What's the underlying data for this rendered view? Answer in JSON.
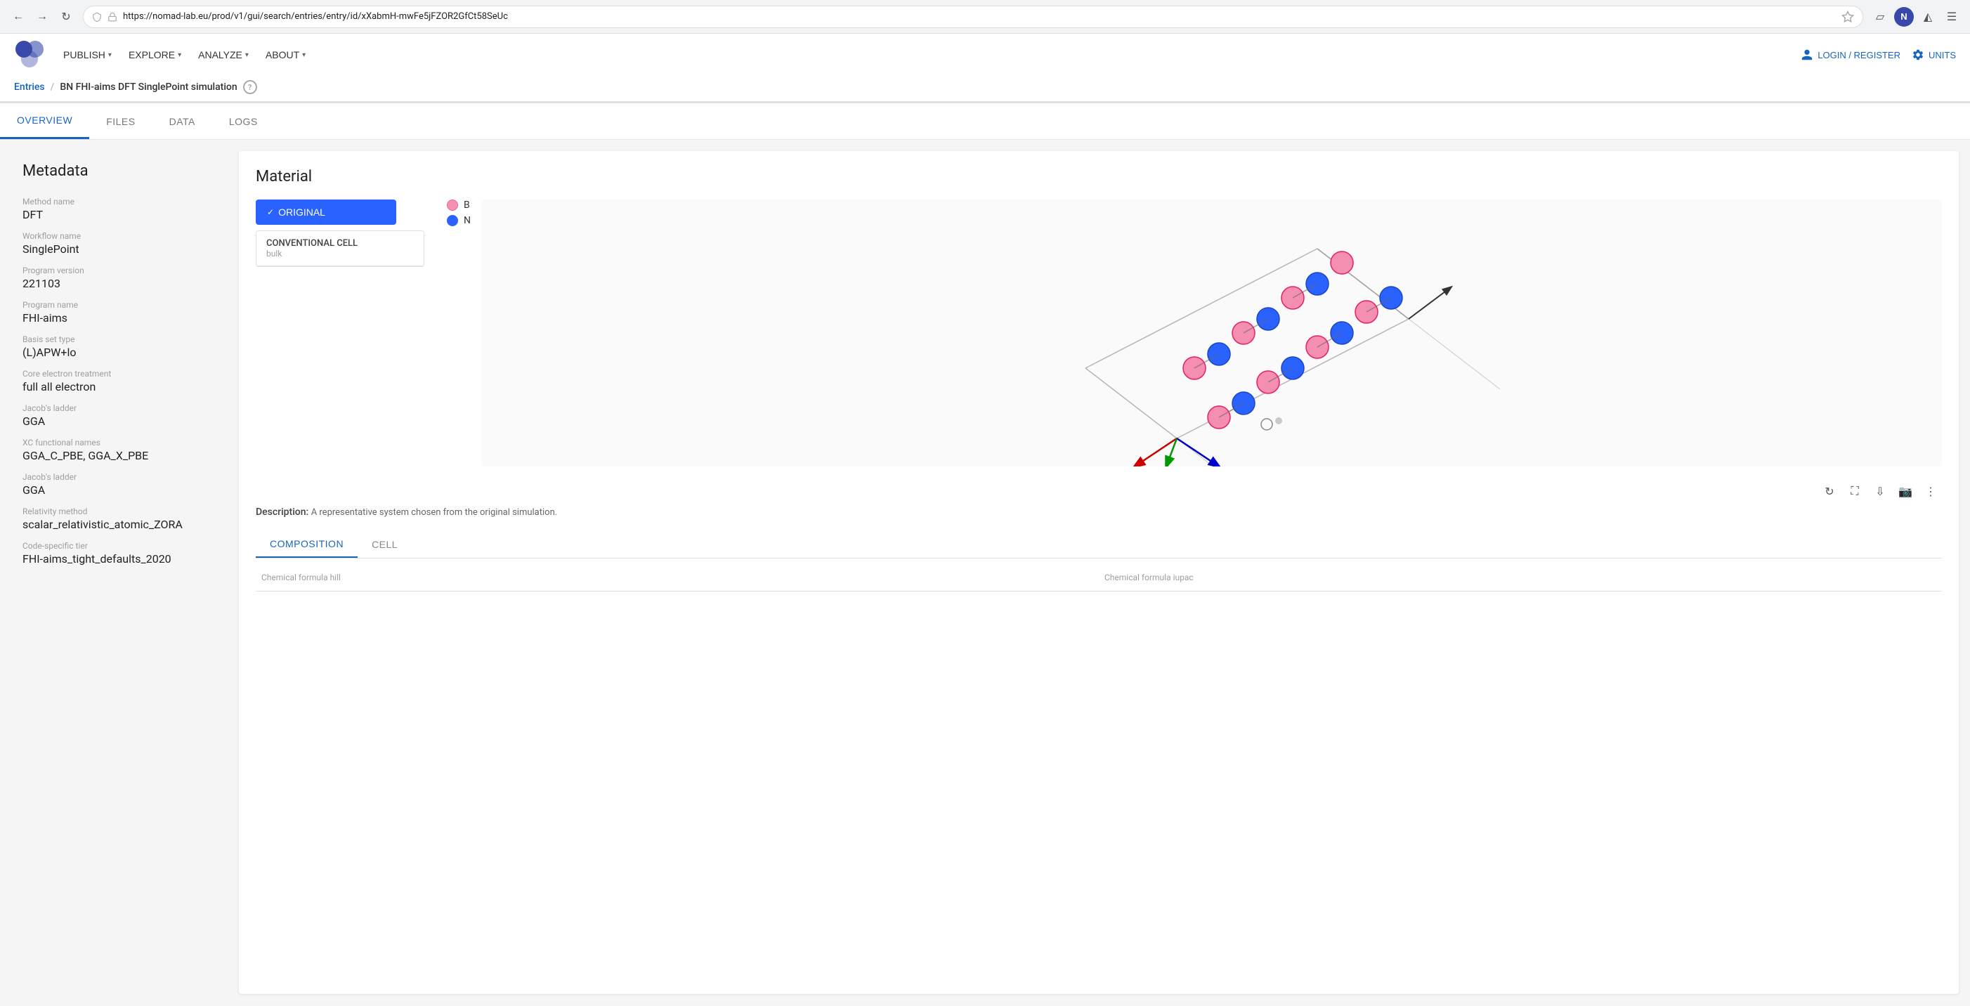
{
  "browser": {
    "url": "https://nomad-lab.eu/prod/v1/gui/search/entries/entry/id/xXabmH-mwFe5jFZOR2GfCt58SeUc",
    "back_label": "←",
    "forward_label": "→",
    "refresh_label": "↻"
  },
  "header": {
    "logo_alt": "NOMAD",
    "nav": [
      {
        "label": "PUBLISH",
        "has_arrow": true
      },
      {
        "label": "EXPLORE",
        "has_arrow": true
      },
      {
        "label": "ANALYZE",
        "has_arrow": true
      },
      {
        "label": "ABOUT",
        "has_arrow": true
      }
    ],
    "login_label": "LOGIN / REGISTER",
    "units_label": "UNITS",
    "breadcrumb_home": "Entries",
    "breadcrumb_current": "BN FHI-aims DFT SinglePoint simulation",
    "help_tooltip": "?"
  },
  "tabs": [
    {
      "label": "OVERVIEW",
      "active": true
    },
    {
      "label": "FILES",
      "active": false
    },
    {
      "label": "DATA",
      "active": false
    },
    {
      "label": "LOGS",
      "active": false
    }
  ],
  "metadata": {
    "title": "Metadata",
    "items": [
      {
        "label": "Method name",
        "value": "DFT"
      },
      {
        "label": "Workflow name",
        "value": "SinglePoint"
      },
      {
        "label": "Program version",
        "value": "221103"
      },
      {
        "label": "Program name",
        "value": "FHI-aims"
      },
      {
        "label": "Basis set type",
        "value": "(L)APW+lo"
      },
      {
        "label": "Core electron treatment",
        "value": "full all electron"
      },
      {
        "label": "Jacob's ladder",
        "value": "GGA"
      },
      {
        "label": "XC functional names",
        "value": "GGA_C_PBE, GGA_X_PBE"
      },
      {
        "label": "Jacob's ladder",
        "value": "GGA"
      },
      {
        "label": "Relativity method",
        "value": "scalar_relativistic_atomic_ZORA"
      },
      {
        "label": "Code-specific tier",
        "value": "FHI-aims_tight_defaults_2020"
      }
    ]
  },
  "material": {
    "title": "Material",
    "original_label": "ORIGINAL",
    "legend": [
      {
        "symbol": "B",
        "color": "#f48fb1"
      },
      {
        "symbol": "N",
        "color": "#2962ff"
      }
    ],
    "cell": {
      "header": "CONVENTIONAL CELL",
      "subtext": "bulk"
    },
    "description_title": "Description:",
    "description_text": "A representative system chosen from the original simulation.",
    "viz_controls": [
      {
        "label": "↺",
        "name": "reset-view"
      },
      {
        "label": "⤢",
        "name": "fullscreen"
      },
      {
        "label": "⬇",
        "name": "download"
      },
      {
        "label": "📷",
        "name": "screenshot"
      },
      {
        "label": "⋮",
        "name": "more-options"
      }
    ],
    "bottom_tabs": [
      {
        "label": "COMPOSITION",
        "active": true
      },
      {
        "label": "CELL",
        "active": false
      }
    ],
    "table_headers": [
      "Chemical formula hill",
      "Chemical formula iupac"
    ]
  }
}
